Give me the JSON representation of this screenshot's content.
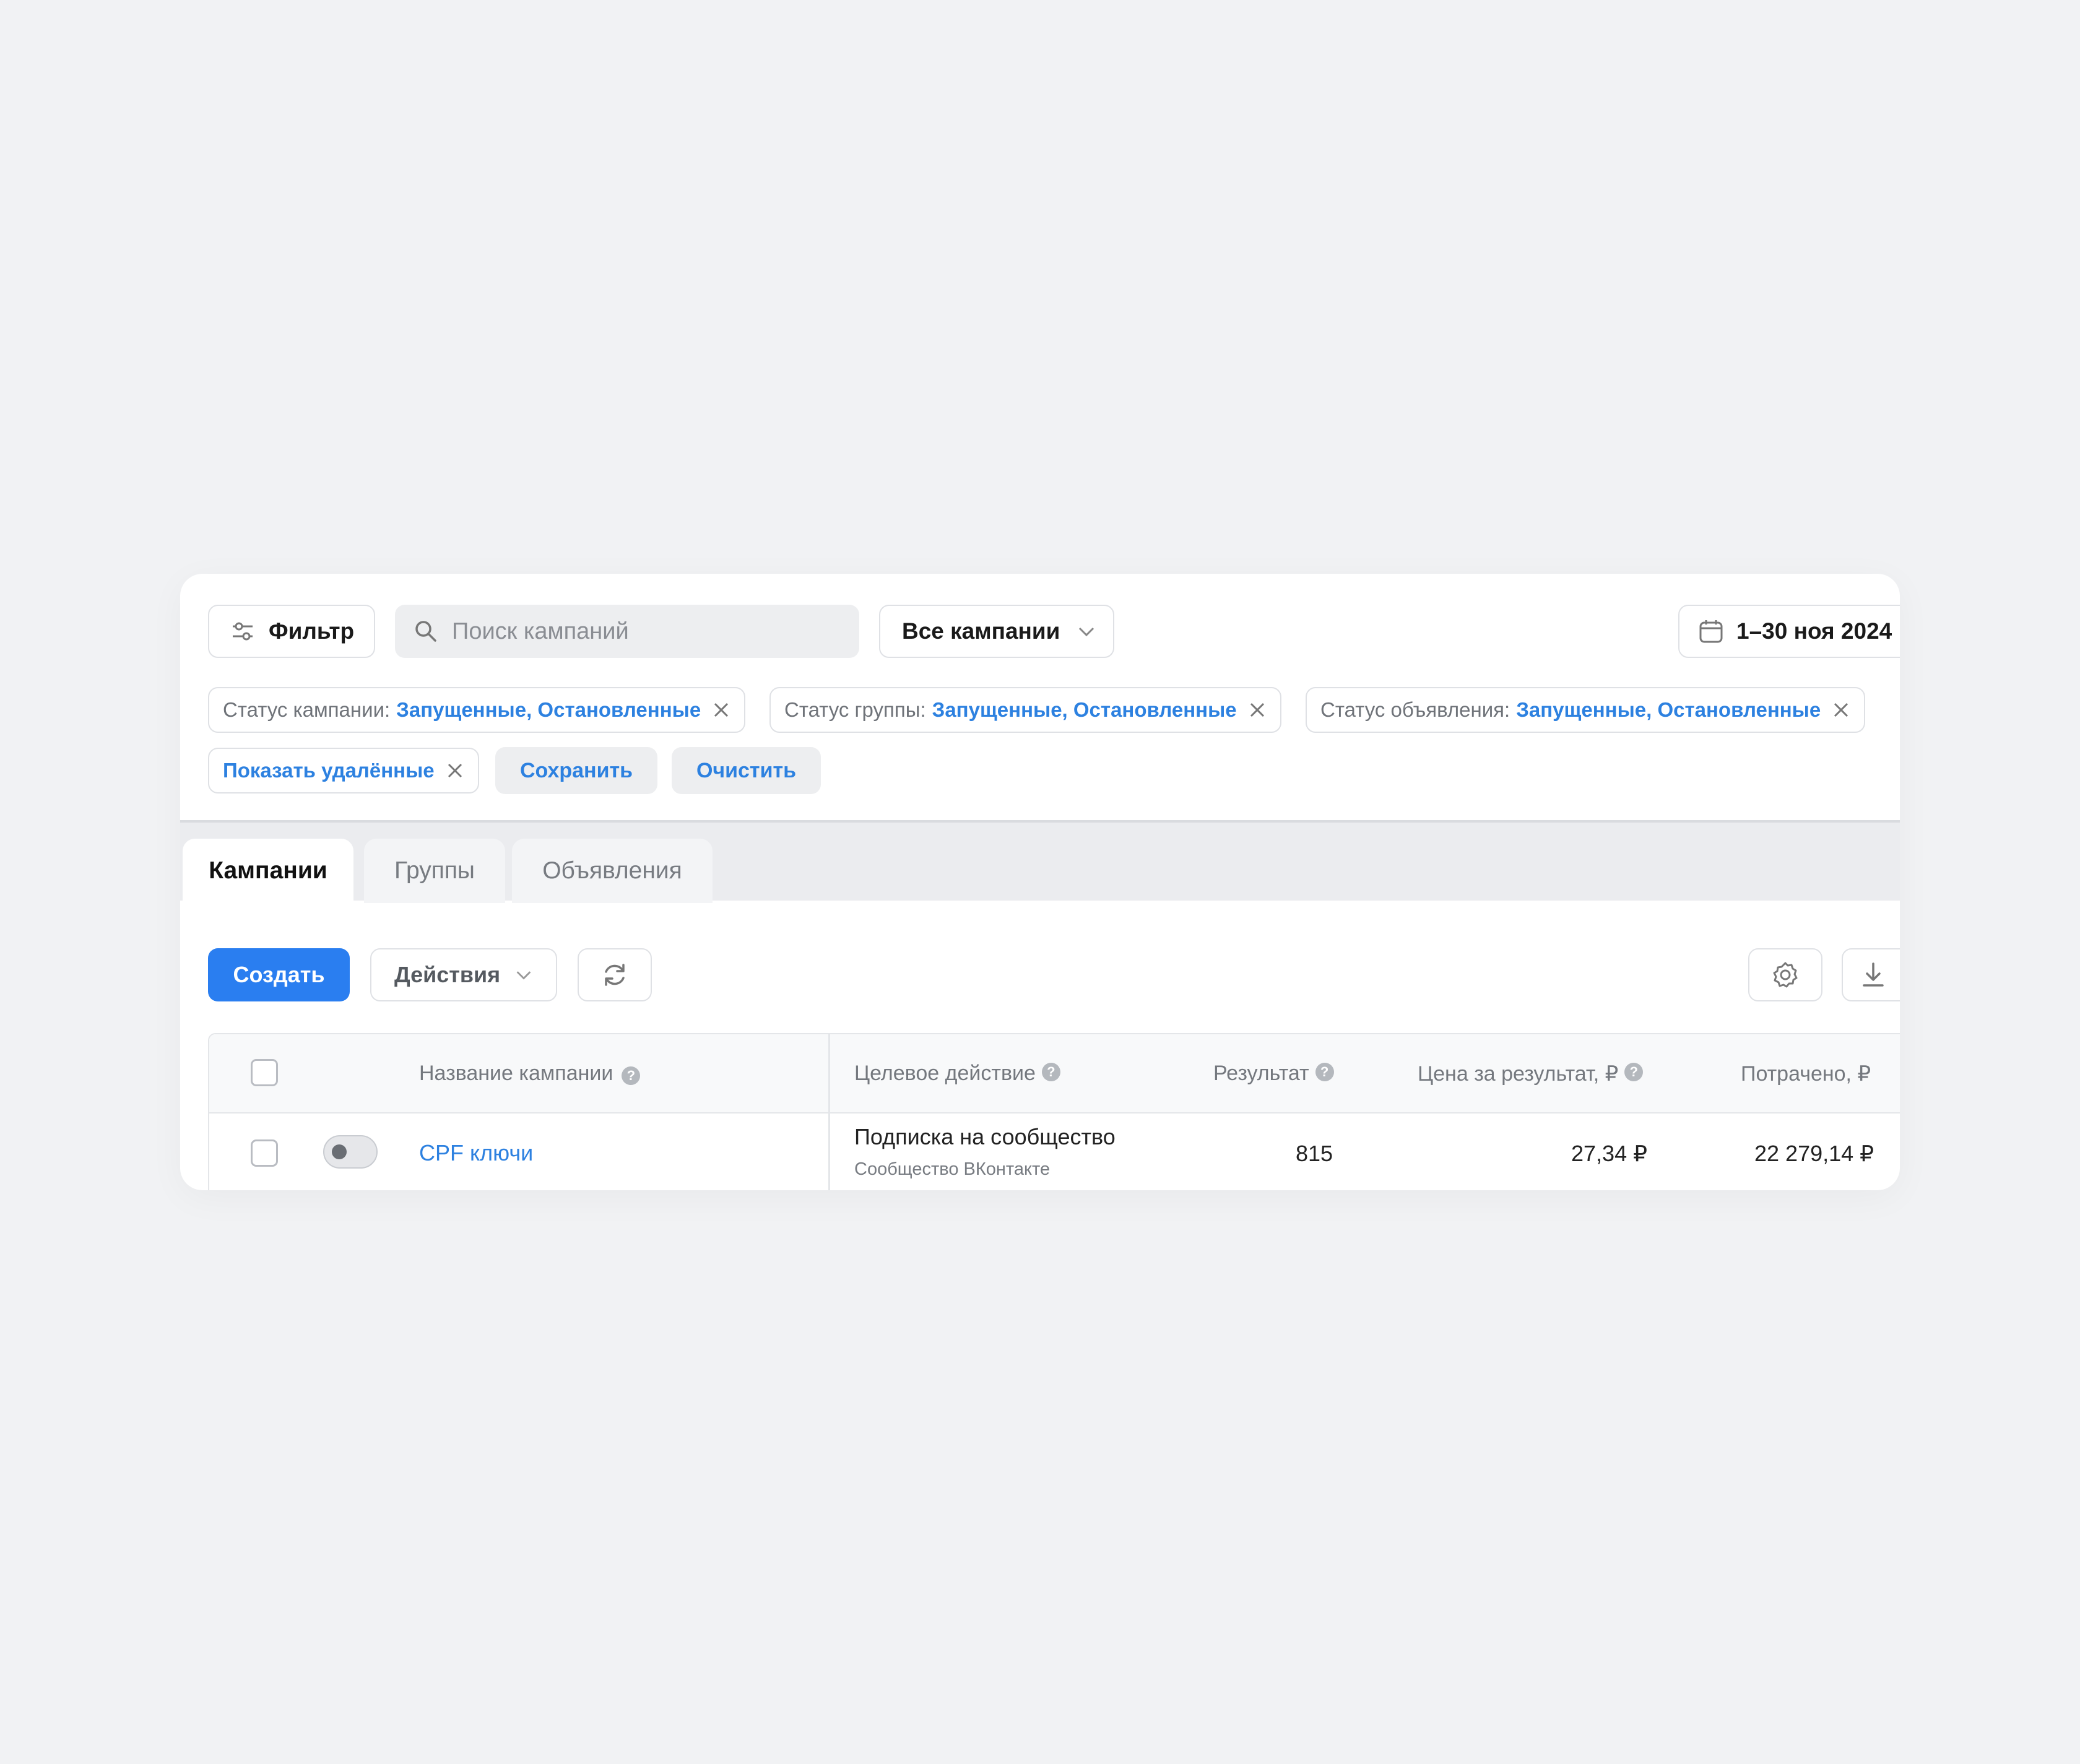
{
  "toolbar": {
    "filter_label": "Фильтр",
    "search_placeholder": "Поиск кампаний",
    "campaigns_dropdown": "Все кампании",
    "date_range": "1–30 ноя 2024"
  },
  "filters": {
    "chips": [
      {
        "label": "Статус кампании:",
        "value": "Запущенные, Остановленные"
      },
      {
        "label": "Статус группы:",
        "value": "Запущенные, Остановленные"
      },
      {
        "label": "Статус объявления:",
        "value": "Запущенные, Остановленные"
      }
    ],
    "show_deleted": "Показать удалённые",
    "save_label": "Сохранить",
    "clear_label": "Очистить"
  },
  "tabs": [
    {
      "label": "Кампании",
      "active": true
    },
    {
      "label": "Группы",
      "active": false
    },
    {
      "label": "Объявления",
      "active": false
    }
  ],
  "actions": {
    "create_label": "Создать",
    "actions_label": "Действия"
  },
  "table": {
    "headers": {
      "name": "Название кампании",
      "target": "Целевое действие",
      "result": "Результат",
      "price": "Цена за результат, ₽",
      "spent": "Потрачено, ₽"
    },
    "rows": [
      {
        "name": "CPF ключи",
        "target": "Подписка на сообщество",
        "target_sub": "Сообщество ВКонтакте",
        "result": "815",
        "price": "27,34 ₽",
        "spent": "22 279,14 ₽",
        "enabled": false
      }
    ]
  },
  "colors": {
    "accent": "#2a7ef0",
    "link": "#2d81e0",
    "background": "#f1f2f4"
  }
}
